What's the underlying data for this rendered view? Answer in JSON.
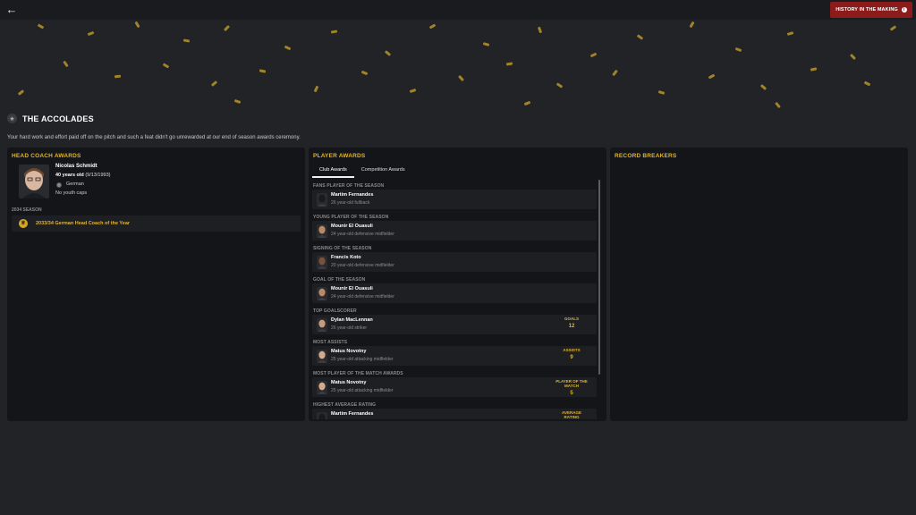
{
  "topbar": {
    "history_button": "HISTORY IN THE MAKING",
    "back_icon": "arrow-left-icon",
    "info_icon": "info-icon"
  },
  "accolades": {
    "title": "THE ACCOLADES",
    "description": "Your hard work and effort paid off on the pitch and such a feat didn't go unrewarded at our end of season awards ceremony."
  },
  "head_coach": {
    "title": "HEAD COACH AWARDS",
    "name": "Nicolas Schmidt",
    "age": "40 years old",
    "dob": "(9/13/1993)",
    "nationality": "German",
    "youth_caps": "No youth caps",
    "season": "2034 SEASON",
    "award": "2033/34 German Head Coach of the Year"
  },
  "player_awards": {
    "title": "PLAYER AWARDS",
    "tabs": [
      "Club Awards",
      "Competition Awards"
    ],
    "items": [
      {
        "category": "FANS PLAYER OF THE SEASON",
        "name": "Martim Fernandes",
        "desc": "26 year-old fullback",
        "stat_label": "",
        "stat_value": ""
      },
      {
        "category": "YOUNG PLAYER OF THE SEASON",
        "name": "Mounir El Ouasuli",
        "desc": "24 year-old defensive midfielder",
        "stat_label": "",
        "stat_value": ""
      },
      {
        "category": "SIGNING OF THE SEASON",
        "name": "Francis Koto",
        "desc": "20 year-old defensive midfielder",
        "stat_label": "",
        "stat_value": ""
      },
      {
        "category": "GOAL OF THE SEASON",
        "name": "Mounir El Ouasuli",
        "desc": "24 year-old defensive midfielder",
        "stat_label": "",
        "stat_value": ""
      },
      {
        "category": "TOP GOALSCORER",
        "name": "Dylan MacLennan",
        "desc": "26 year-old striker",
        "stat_label": "GOALS",
        "stat_value": "12"
      },
      {
        "category": "MOST ASSISTS",
        "name": "Matus Novotny",
        "desc": "25 year-old attacking midfielder",
        "stat_label": "ASSISTS",
        "stat_value": "9"
      },
      {
        "category": "MOST PLAYER OF THE MATCH AWARDS",
        "name": "Matus Novotny",
        "desc": "25 year-old attacking midfielder",
        "stat_label": "PLAYER OF THE MATCH",
        "stat_value": "5"
      },
      {
        "category": "HIGHEST AVERAGE RATING",
        "name": "Martim Fernandes",
        "desc": "",
        "stat_label": "AVERAGE RATING",
        "stat_value": ""
      }
    ]
  },
  "record_breakers": {
    "title": "RECORD BREAKERS"
  },
  "colors": {
    "accent": "#e3b52a",
    "history_button": "#8c1c1c",
    "panel": "#141518",
    "background": "#222326"
  }
}
